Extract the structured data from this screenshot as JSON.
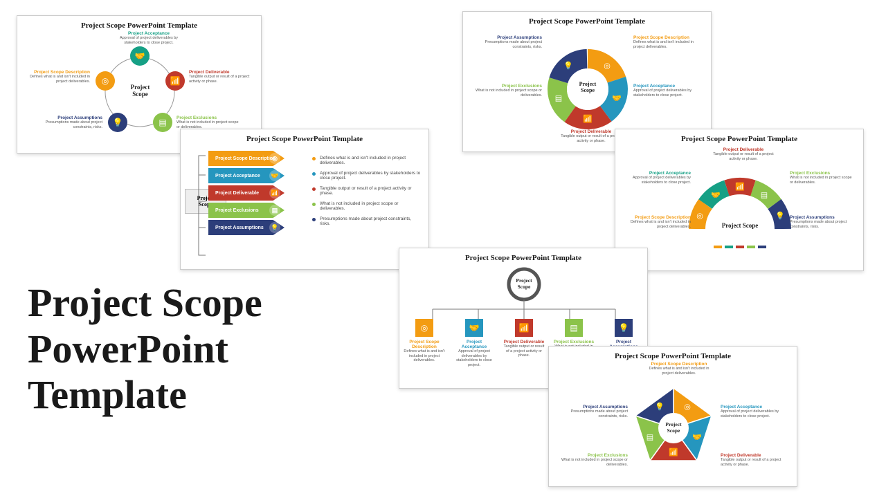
{
  "main_title": "Project Scope\nPowerPoint\nTemplate",
  "slide_title": "Project Scope PowerPoint Template",
  "center": "Project Scope",
  "center_2line": "Project\nScope",
  "items": {
    "desc": {
      "label": "Project Scope Description",
      "text": "Defines what is and isn't included in project deliverables."
    },
    "accept": {
      "label": "Project Acceptance",
      "text": "Approval of project deliverables by stakeholders to close project."
    },
    "deliv": {
      "label": "Project Deliverable",
      "text": "Tangible output or result of a project activity or phase."
    },
    "excl": {
      "label": "Project Exclusions",
      "text": "What is not included in project scope or deliverables."
    },
    "assum": {
      "label": "Project Assumptions",
      "text": "Presumptions made about project constraints, risks."
    }
  },
  "icons": {
    "desc": "◎",
    "accept": "🤝",
    "deliv": "📶",
    "excl": "▤",
    "assum": "💡"
  }
}
